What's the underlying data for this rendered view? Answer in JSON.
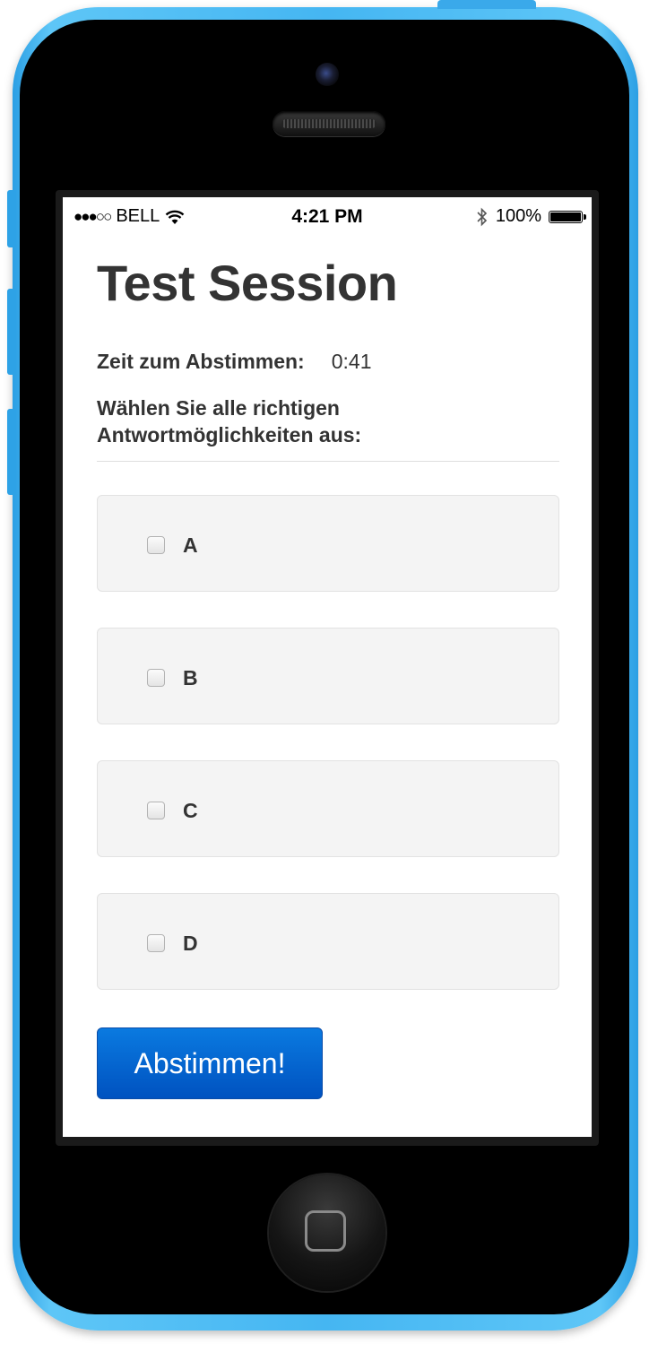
{
  "status_bar": {
    "signal": "●●●○○",
    "carrier": "BELL",
    "time": "4:21 PM",
    "battery_percent": "100%"
  },
  "page": {
    "title": "Test Session",
    "timer_label": "Zeit zum Abstimmen:",
    "timer_value": "0:41",
    "instruction": "Wählen Sie alle richtigen Antwortmöglichkeiten aus:"
  },
  "options": [
    {
      "label": "A",
      "checked": false
    },
    {
      "label": "B",
      "checked": false
    },
    {
      "label": "C",
      "checked": false
    },
    {
      "label": "D",
      "checked": false
    }
  ],
  "submit_label": "Abstimmen!",
  "colors": {
    "phone_case": "#45b6f2",
    "button_blue": "#0a66d4",
    "option_bg": "#f4f4f4",
    "text": "#333333"
  }
}
